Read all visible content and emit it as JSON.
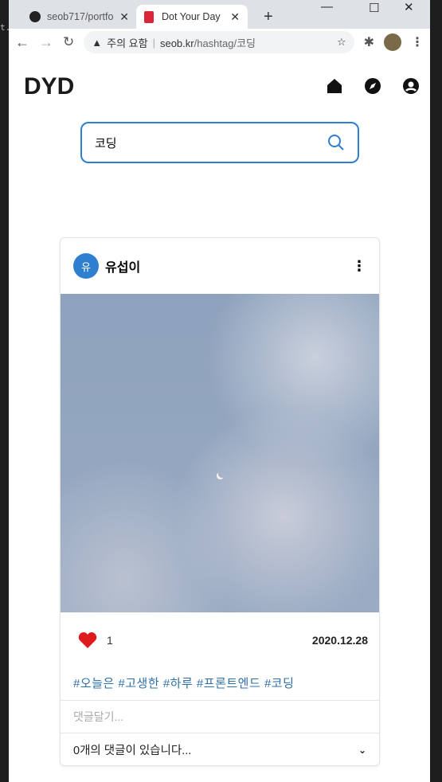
{
  "browser": {
    "tabs": [
      {
        "title": "seob717/portfo"
      },
      {
        "title": "Dot Your Day"
      }
    ],
    "new_tab": "+",
    "security": "주의 요함",
    "url_host": "seob.kr",
    "url_path": "/hashtag/코딩"
  },
  "header": {
    "logo": "DYD"
  },
  "search": {
    "value": "코딩"
  },
  "post": {
    "avatar_letter": "유",
    "username": "유섭이",
    "likes": "1",
    "date": "2020.12.28",
    "tags": "#오늘은 #고생한 #하루 #프론트엔드 #코딩",
    "comment_placeholder": "댓글달기...",
    "comment_count_text": "0개의 댓글이 있습니다..."
  },
  "colors": {
    "accent": "#2f7fd0",
    "heart": "#e0191e"
  }
}
